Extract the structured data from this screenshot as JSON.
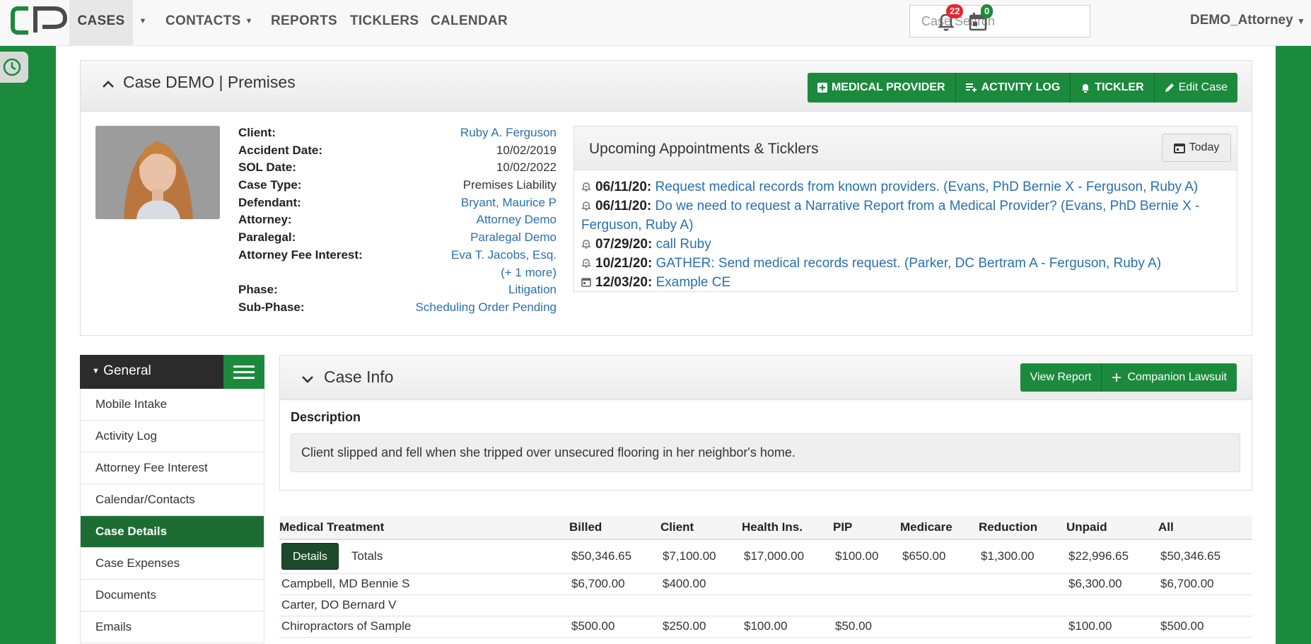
{
  "nav": {
    "items": [
      {
        "label": "CASES",
        "active": true,
        "caret": true
      },
      {
        "label": "CONTACTS",
        "caret": true
      },
      {
        "label": "REPORTS"
      },
      {
        "label": "TICKLERS"
      },
      {
        "label": "CALENDAR"
      }
    ],
    "search_placeholder": "Case Search",
    "notifications": "22",
    "calendar_count": "0",
    "user": "DEMO_Attorney"
  },
  "colors": {
    "brand_green": "#1b8a3c",
    "dark_green": "#1d6d33",
    "link": "#2a6fb0",
    "badge_red": "#e8252b"
  },
  "case": {
    "title": "Case DEMO | Premises",
    "buttons": {
      "medical_provider": "MEDICAL PROVIDER",
      "activity_log": "ACTIVITY LOG",
      "tickler": "TICKLER",
      "edit_case": "Edit Case"
    },
    "fields": [
      {
        "label": "Client:",
        "value": "Ruby A. Ferguson",
        "link": true
      },
      {
        "label": "Accident Date:",
        "value": "10/02/2019"
      },
      {
        "label": "SOL Date:",
        "value": "10/02/2022"
      },
      {
        "label": "Case Type:",
        "value": "Premises Liability"
      },
      {
        "label": "Defendant:",
        "value": "Bryant, Maurice P",
        "link": true
      },
      {
        "label": "Attorney:",
        "value": "Attorney Demo",
        "link": true
      },
      {
        "label": "Paralegal:",
        "value": "Paralegal Demo",
        "link": true
      },
      {
        "label": "Attorney Fee Interest:",
        "value": "Eva T. Jacobs, Esq.",
        "link": true
      },
      {
        "label": "",
        "value": "(+ 1 more)",
        "link": true
      },
      {
        "label": "Phase:",
        "value": "Litigation",
        "link": true
      },
      {
        "label": "Sub-Phase:",
        "value": "Scheduling Order Pending",
        "link": true
      }
    ]
  },
  "appointments": {
    "title": "Upcoming Appointments & Ticklers",
    "today_label": "Today",
    "items": [
      {
        "icon": "tickler-icon",
        "date": "06/11/20:",
        "text": "Request medical records from known providers. (Evans, PhD Bernie X - Ferguson, Ruby A)"
      },
      {
        "icon": "tickler-icon",
        "date": "06/11/20:",
        "text": "Do we need to request a Narrative Report from a Medical Provider? (Evans, PhD Bernie X - Ferguson, Ruby A)"
      },
      {
        "icon": "tickler-icon",
        "date": "07/29/20:",
        "text": "call Ruby"
      },
      {
        "icon": "tickler-icon",
        "date": "10/21/20:",
        "text": "GATHER: Send medical records request. (Parker, DC Bertram A - Ferguson, Ruby A)"
      },
      {
        "icon": "calendar-icon",
        "date": "12/03/20:",
        "text": "Example CE"
      }
    ]
  },
  "menu": {
    "title": "General",
    "items": [
      {
        "label": "Mobile Intake"
      },
      {
        "label": "Activity Log"
      },
      {
        "label": "Attorney Fee Interest"
      },
      {
        "label": "Calendar/Contacts"
      },
      {
        "label": "Case Details",
        "active": true
      },
      {
        "label": "Case Expenses"
      },
      {
        "label": "Documents"
      },
      {
        "label": "Emails"
      }
    ]
  },
  "case_info": {
    "title": "Case Info",
    "view_report": "View Report",
    "companion_lawsuit": "Companion Lawsuit",
    "description_label": "Description",
    "description": "Client slipped and fell when she tripped over unsecured flooring in her neighbor's home."
  },
  "medical": {
    "headers": [
      "Medical Treatment",
      "Billed",
      "Client",
      "Health Ins.",
      "PIP",
      "Medicare",
      "Reduction",
      "Unpaid",
      "All"
    ],
    "details_label": "Details",
    "totals_label": "Totals",
    "totals": [
      "$50,346.65",
      "$7,100.00",
      "$17,000.00",
      "$100.00",
      "$650.00",
      "$1,300.00",
      "$22,996.65",
      "$50,346.65"
    ],
    "rows": [
      {
        "name": "Campbell, MD Bennie S",
        "cells": [
          "$6,700.00",
          "$400.00",
          "",
          "",
          "",
          "",
          "$6,300.00",
          "$6,700.00"
        ]
      },
      {
        "name": "Carter, DO Bernard V",
        "cells": [
          "",
          "",
          "",
          "",
          "",
          "",
          "",
          ""
        ]
      },
      {
        "name": "Chiropractors of Sample",
        "cells": [
          "$500.00",
          "$250.00",
          "$100.00",
          "$50.00",
          "",
          "",
          "$100.00",
          "$500.00"
        ]
      }
    ]
  }
}
